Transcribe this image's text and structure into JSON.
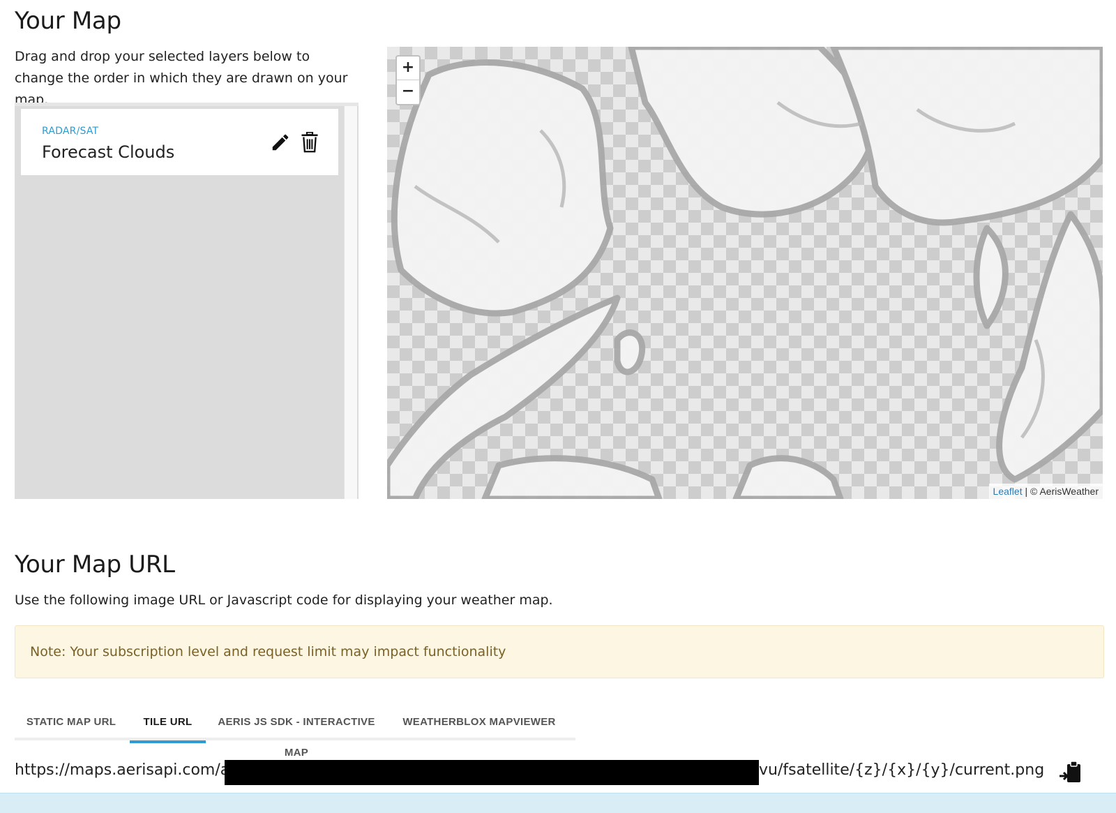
{
  "page": {
    "title": "Your Map",
    "intro": "Drag and drop your selected layers below to change the order in which they are drawn on your map."
  },
  "layers": [
    {
      "category": "RADAR/SAT",
      "name": "Forecast Clouds",
      "edit_icon": "pencil-icon",
      "delete_icon": "trash-icon"
    }
  ],
  "map": {
    "zoom_in": "+",
    "zoom_out": "−",
    "attribution_link": "Leaflet",
    "attribution_text": " | © AerisWeather"
  },
  "url_section": {
    "title": "Your Map URL",
    "description": "Use the following image URL or Javascript code for displaying your weather map.",
    "note": "Note: Your subscription level and request limit may impact functionality",
    "tabs": [
      {
        "label": "STATIC MAP URL",
        "active": false
      },
      {
        "label": "TILE URL",
        "active": true
      },
      {
        "label": "AERIS JS SDK - INTERACTIVE MAP",
        "active": false
      },
      {
        "label": "WEATHERBLOX MAPVIEWER",
        "active": false
      }
    ],
    "url_prefix": "https://maps.aerisapi.com/an",
    "url_suffix": "vu/fsatellite/{z}/{x}/{y}/current.png",
    "copy_icon": "clipboard-icon"
  },
  "colors": {
    "accent": "#2f9bd0",
    "note_bg": "#fcf6e2",
    "note_text": "#7a6127",
    "panel_bg": "#dcdcdc"
  }
}
